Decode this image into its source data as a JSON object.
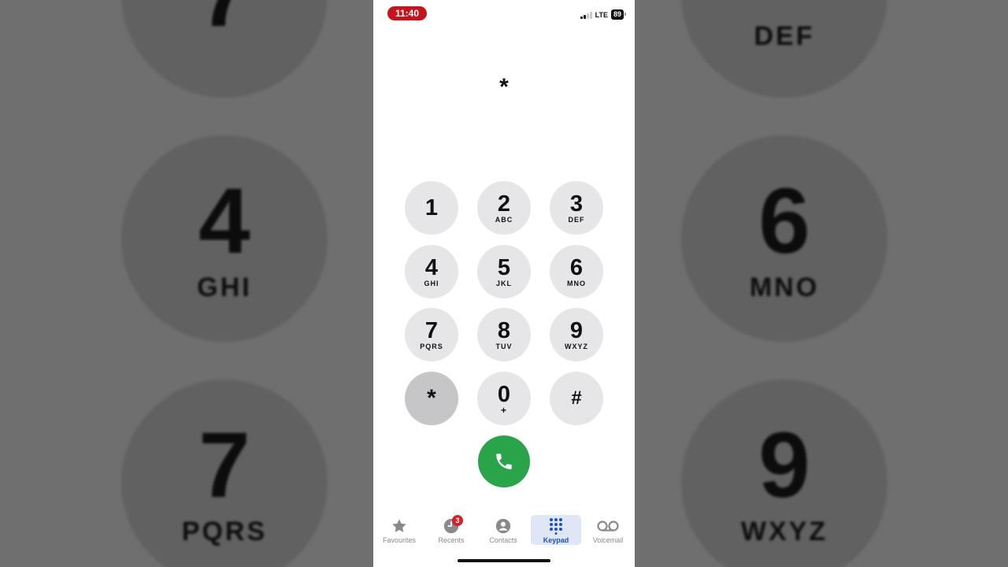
{
  "background_keys": [
    {
      "digit": "7",
      "letters": ""
    },
    {
      "digit": "",
      "letters": "DEF"
    },
    {
      "digit": "4",
      "letters": "GHI"
    },
    {
      "digit": "6",
      "letters": "MNO"
    },
    {
      "digit": "7",
      "letters": "PQRS"
    },
    {
      "digit": "9",
      "letters": "WXYZ"
    }
  ],
  "status": {
    "time": "11:40",
    "network": "LTE",
    "battery": "89",
    "time_pill_color": "#c4141d"
  },
  "dialer": {
    "entered_number": "*",
    "keys": [
      {
        "digit": "1",
        "letters": ""
      },
      {
        "digit": "2",
        "letters": "ABC"
      },
      {
        "digit": "3",
        "letters": "DEF"
      },
      {
        "digit": "4",
        "letters": "GHI"
      },
      {
        "digit": "5",
        "letters": "JKL"
      },
      {
        "digit": "6",
        "letters": "MNO"
      },
      {
        "digit": "7",
        "letters": "PQRS"
      },
      {
        "digit": "8",
        "letters": "TUV"
      },
      {
        "digit": "9",
        "letters": "WXYZ"
      },
      {
        "digit": "*",
        "letters": ""
      },
      {
        "digit": "0",
        "letters": "+"
      },
      {
        "digit": "#",
        "letters": ""
      }
    ],
    "pressed_key": "*",
    "call_button_color": "#2aa44a"
  },
  "tabs": [
    {
      "label": "Favourites",
      "icon": "star-icon",
      "active": false
    },
    {
      "label": "Recents",
      "icon": "clock-icon",
      "active": false,
      "badge": "3"
    },
    {
      "label": "Contacts",
      "icon": "person-icon",
      "active": false
    },
    {
      "label": "Keypad",
      "icon": "keypad-icon",
      "active": true
    },
    {
      "label": "Voicemail",
      "icon": "voicemail-icon",
      "active": false
    }
  ],
  "accent_color": "#1e4fc7"
}
